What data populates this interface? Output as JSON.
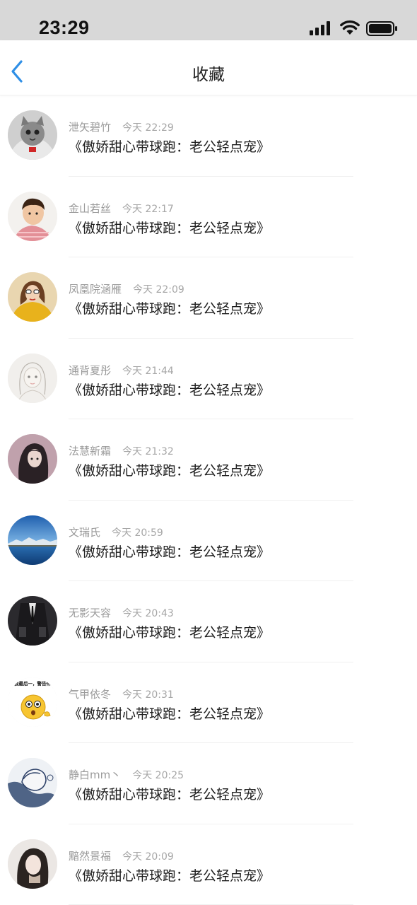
{
  "status_bar": {
    "time": "23:29"
  },
  "nav": {
    "title": "收藏"
  },
  "items": [
    {
      "name": "泄矢碧竹",
      "time": "今天 22:29",
      "title": "《傲娇甜心带球跑：老公轻点宠》"
    },
    {
      "name": "金山若丝",
      "time": "今天 22:17",
      "title": "《傲娇甜心带球跑：老公轻点宠》"
    },
    {
      "name": "凤凰院涵雁",
      "time": "今天 22:09",
      "title": "《傲娇甜心带球跑：老公轻点宠》"
    },
    {
      "name": "通背夏彤",
      "time": "今天 21:44",
      "title": "《傲娇甜心带球跑：老公轻点宠》"
    },
    {
      "name": "法慧新霜",
      "time": "今天 21:32",
      "title": "《傲娇甜心带球跑：老公轻点宠》"
    },
    {
      "name": "文瑞氏",
      "time": "今天 20:59",
      "title": "《傲娇甜心带球跑：老公轻点宠》"
    },
    {
      "name": "无影天容",
      "time": "今天 20:43",
      "title": "《傲娇甜心带球跑：老公轻点宠》"
    },
    {
      "name": "气甲依冬",
      "time": "今天 20:31",
      "title": "《傲娇甜心带球跑：老公轻点宠》",
      "avatar_text": "食，我最后一，警告你！！"
    },
    {
      "name": "静白mm丶",
      "time": "今天 20:25",
      "title": "《傲娇甜心带球跑：老公轻点宠》"
    },
    {
      "name": "黯然景福",
      "time": "今天 20:09",
      "title": "《傲娇甜心带球跑：老公轻点宠》"
    }
  ]
}
